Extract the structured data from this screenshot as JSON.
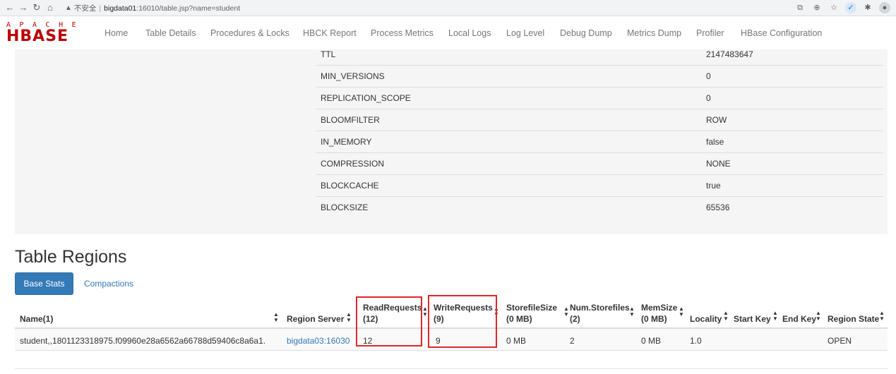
{
  "browser": {
    "back_icon": "arrow-left-icon",
    "forward_icon": "arrow-right-icon",
    "reload_icon": "reload-icon",
    "home_icon": "home-icon",
    "security_icon": "warning-triangle-icon",
    "security_label": "不安全",
    "url_host": "bigdata01",
    "url_path": ":16010/table.jsp?name=student"
  },
  "navbar": {
    "logo_top": "APACHE",
    "logo_main": "HBASE",
    "links": [
      "Home",
      "Table Details",
      "Procedures & Locks",
      "HBCK Report",
      "Process Metrics",
      "Local Logs",
      "Log Level",
      "Debug Dump",
      "Metrics Dump",
      "Profiler",
      "HBase Configuration"
    ]
  },
  "schema": {
    "rows": [
      {
        "key": "TTL",
        "value": "2147483647"
      },
      {
        "key": "MIN_VERSIONS",
        "value": "0"
      },
      {
        "key": "REPLICATION_SCOPE",
        "value": "0"
      },
      {
        "key": "BLOOMFILTER",
        "value": "ROW"
      },
      {
        "key": "IN_MEMORY",
        "value": "false"
      },
      {
        "key": "COMPRESSION",
        "value": "NONE"
      },
      {
        "key": "BLOCKCACHE",
        "value": "true"
      },
      {
        "key": "BLOCKSIZE",
        "value": "65536"
      }
    ]
  },
  "regions": {
    "title": "Table Regions",
    "tabs": {
      "base_stats": "Base Stats",
      "compactions": "Compactions"
    },
    "headers": {
      "name": "Name(1)",
      "region_server": "Region Server",
      "read_requests": "ReadRequests",
      "read_requests_sub": "(12)",
      "write_requests": "WriteRequests",
      "write_requests_sub": "(9)",
      "storefile_size": "StorefileSize",
      "storefile_size_sub": "(0 MB)",
      "num_storefiles": "Num.Storefiles",
      "num_storefiles_sub": "(2)",
      "mem_size": "MemSize",
      "mem_size_sub": "(0 MB)",
      "locality": "Locality",
      "start_key": "Start Key",
      "end_key": "End Key",
      "region_state": "Region State"
    },
    "row": {
      "name": "student,,1801123318975.f09960e28a6562a66788d59406c8a6a1.",
      "region_server": "bigdata03:16030",
      "read_requests": "12",
      "write_requests": "9",
      "storefile_size": "0 MB",
      "num_storefiles": "2",
      "mem_size": "0 MB",
      "locality": "1.0",
      "start_key": "",
      "end_key": "",
      "region_state": "OPEN"
    },
    "highlight_color": "#e0272b",
    "sort_icon": "sort-icon"
  },
  "colors": {
    "hbase_red": "#bb0000",
    "link_blue": "#337ab7",
    "panel_gray": "#f5f5f5"
  }
}
